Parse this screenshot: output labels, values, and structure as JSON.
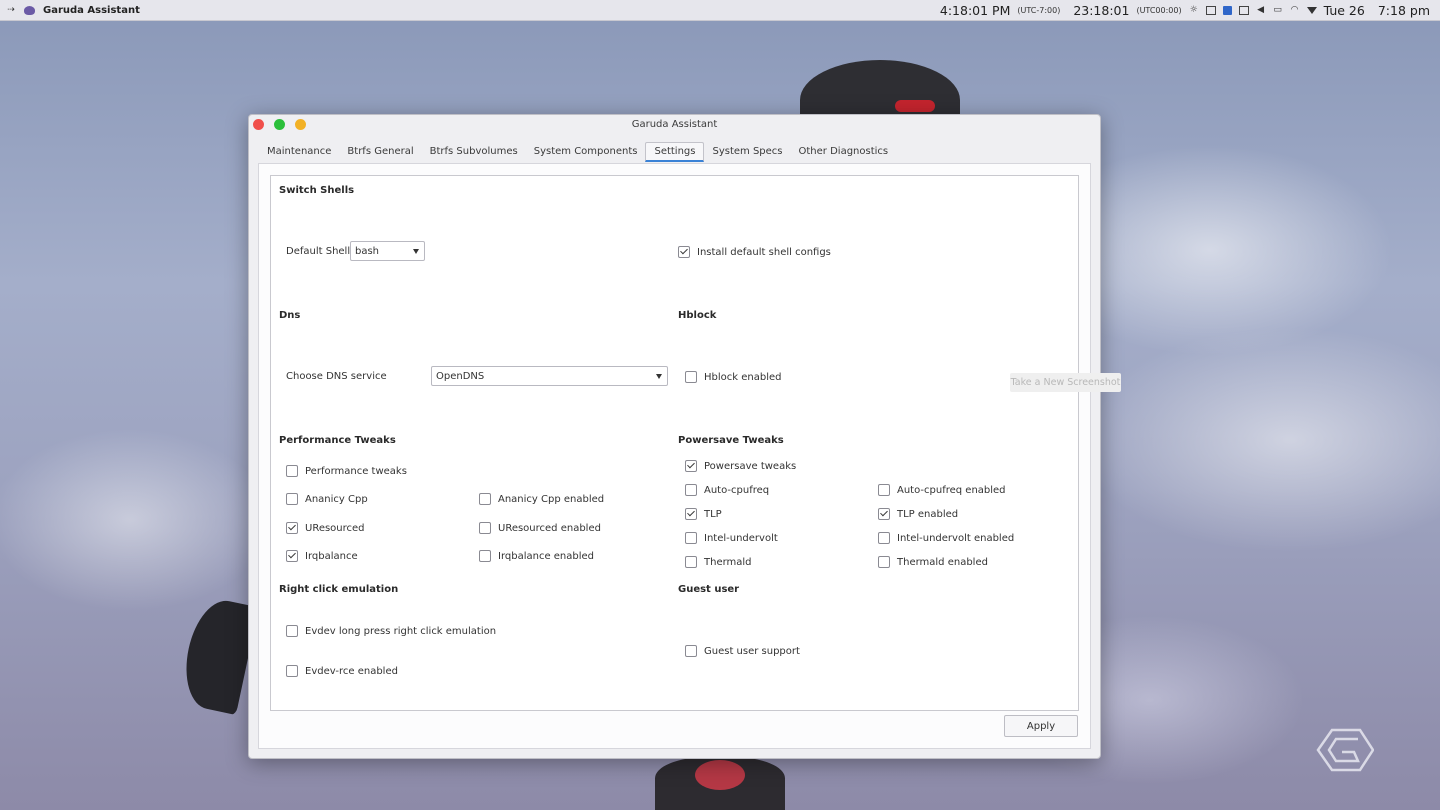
{
  "topbar": {
    "app_name": "Garuda Assistant",
    "local_time": "4:18:01 PM",
    "local_tz": "(UTC-7:00)",
    "utc_time": "23:18:01",
    "utc_tz": "(UTC00:00)",
    "date": "Tue 26",
    "clock": "7:18 pm"
  },
  "window": {
    "title": "Garuda Assistant",
    "tabs": [
      {
        "label": "Maintenance"
      },
      {
        "label": "Btrfs General"
      },
      {
        "label": "Btrfs Subvolumes"
      },
      {
        "label": "System Components"
      },
      {
        "label": "Settings"
      },
      {
        "label": "System Specs"
      },
      {
        "label": "Other Diagnostics"
      }
    ],
    "active_tab": "Settings"
  },
  "switch_shells": {
    "header": "Switch Shells",
    "default_shell_label": "Default Shell:",
    "default_shell_value": "bash",
    "install_configs": {
      "label": "Install default shell configs",
      "checked": true
    }
  },
  "dns": {
    "header": "Dns",
    "choose_label": "Choose DNS service",
    "value": "OpenDNS"
  },
  "hblock": {
    "header": "Hblock",
    "enabled": {
      "label": "Hblock enabled",
      "checked": false
    }
  },
  "performance": {
    "header": "Performance Tweaks",
    "tweaks": {
      "label": "Performance tweaks",
      "checked": false
    },
    "ananicy": {
      "label": "Ananicy Cpp",
      "checked": false
    },
    "ananicy_enabled": {
      "label": "Ananicy Cpp enabled",
      "checked": false
    },
    "uresourced": {
      "label": "UResourced",
      "checked": true
    },
    "uresourced_enabled": {
      "label": "UResourced enabled",
      "checked": false
    },
    "irqbalance": {
      "label": "Irqbalance",
      "checked": true
    },
    "irqbalance_enabled": {
      "label": "Irqbalance enabled",
      "checked": false
    }
  },
  "powersave": {
    "header": "Powersave Tweaks",
    "tweaks": {
      "label": "Powersave tweaks",
      "checked": true
    },
    "autocpufreq": {
      "label": "Auto-cpufreq",
      "checked": false
    },
    "autocpufreq_enabled": {
      "label": "Auto-cpufreq enabled",
      "checked": false
    },
    "tlp": {
      "label": "TLP",
      "checked": true
    },
    "tlp_enabled": {
      "label": "TLP enabled",
      "checked": true
    },
    "undervolt": {
      "label": "Intel-undervolt",
      "checked": false
    },
    "undervolt_enabled": {
      "label": "Intel-undervolt enabled",
      "checked": false
    },
    "thermald": {
      "label": "Thermald",
      "checked": false
    },
    "thermald_enabled": {
      "label": "Thermald enabled",
      "checked": false
    }
  },
  "right_click": {
    "header": "Right click emulation",
    "evdev_long_press": {
      "label": "Evdev long press right click emulation",
      "checked": false
    },
    "evdev_rce": {
      "label": "Evdev-rce enabled",
      "checked": false
    }
  },
  "guest": {
    "header": "Guest user",
    "support": {
      "label": "Guest user support",
      "checked": false
    }
  },
  "apply_label": "Apply",
  "tooltip": "Take a New Screenshot",
  "colors": {
    "accent": "#3a82d6",
    "close": "#f04f4b",
    "maximize": "#2bbf3b",
    "minimize": "#f2b126"
  }
}
